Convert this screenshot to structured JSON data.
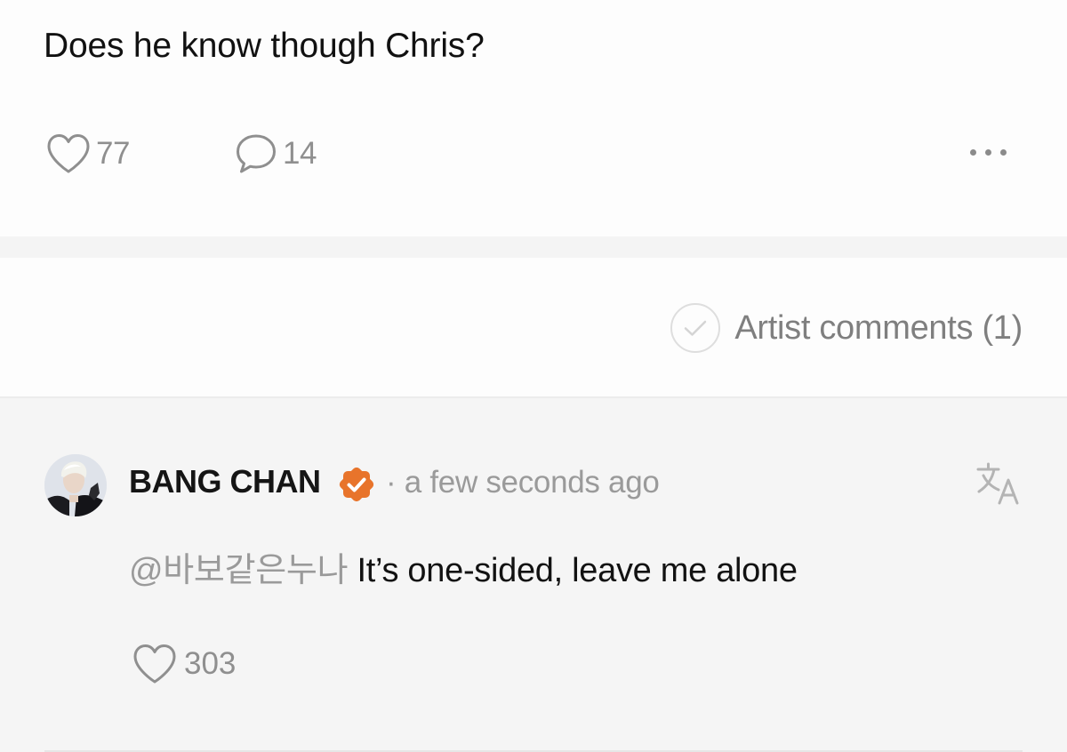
{
  "post": {
    "text": "Does he know though Chris?",
    "like_count": "77",
    "comment_count": "14",
    "like_icon": "heart-outline-icon",
    "comment_icon": "speech-bubble-icon",
    "more_icon": "more-horizontal-icon"
  },
  "filter": {
    "artist_comments_label": "Artist comments (1)",
    "checked": false
  },
  "comment": {
    "author": "BANG CHAN",
    "verified_icon": "verified-badge-icon",
    "timestamp": "· a few seconds ago",
    "mention": "@바보같은누나",
    "text": " It’s one-sided, leave me alone",
    "like_count": "303",
    "translate_icon": "translate-icon"
  },
  "colors": {
    "badge": "#e8742b",
    "muted_text": "#8f8f8f",
    "primary_text": "#111111",
    "comment_background": "#f5f5f5",
    "separator": "#f4f4f4"
  }
}
